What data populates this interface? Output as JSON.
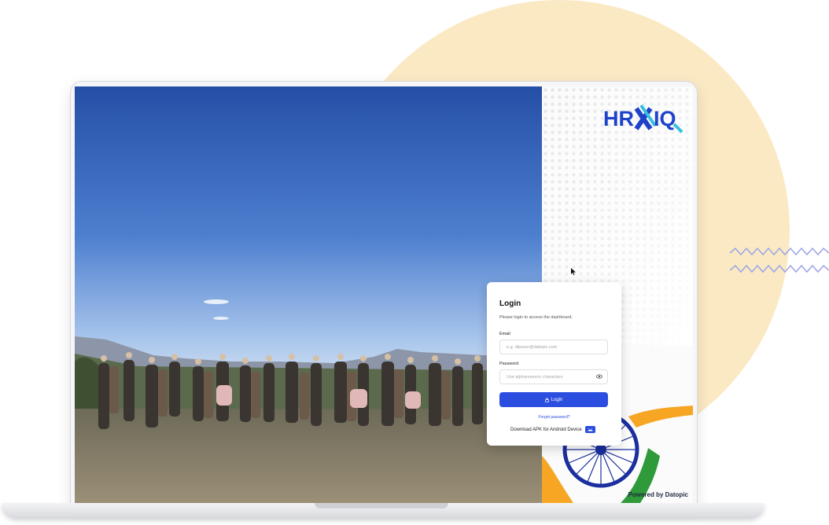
{
  "brand": {
    "logo_text": "HRXIQ",
    "powered_by": "Powered by Datopic",
    "accent": "#2b4ee0",
    "logo_blue": "#1f43c8",
    "logo_cyan": "#35c1dc"
  },
  "login": {
    "title": "Login",
    "subtitle": "Please login to access the dashboard.",
    "email_label": "Email",
    "email_placeholder": "e.g. dtpuser@datopic.com",
    "password_label": "Password",
    "password_placeholder": "Use alphanumeric characters",
    "login_button": "Login",
    "forgot_password": "Forgot password?",
    "download_apk": "Download APK for Android Device"
  },
  "icons": [
    "lock-icon",
    "eye-icon",
    "android-icon",
    "cursor-icon"
  ]
}
